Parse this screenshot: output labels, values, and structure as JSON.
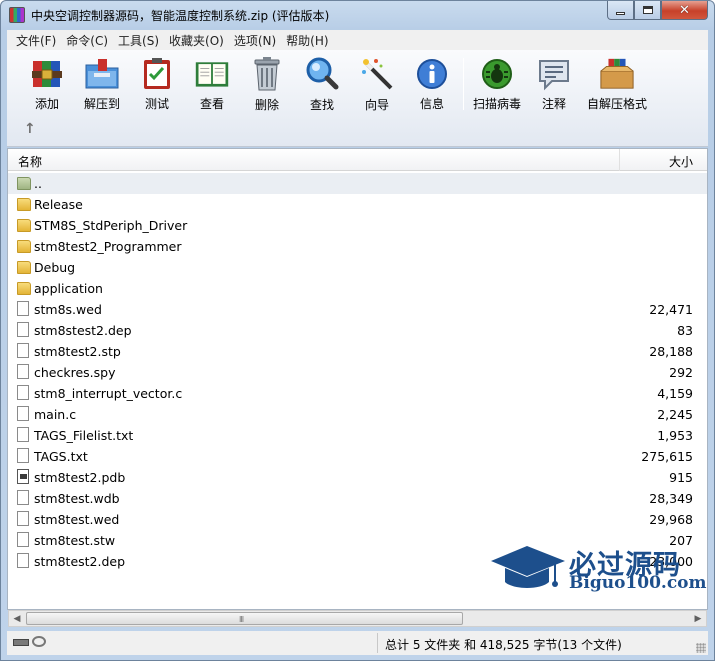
{
  "window": {
    "title": "中央空调控制器源码，智能温度控制系统.zip (评估版本)",
    "controls": {
      "minimize": "minimize-icon",
      "maximize": "maximize-icon",
      "close": "close-icon"
    }
  },
  "menu": [
    "文件(F)",
    "命令(C)",
    "工具(S)",
    "收藏夹(O)",
    "选项(N)",
    "帮助(H)"
  ],
  "toolbar": {
    "buttons": [
      {
        "label": "添加",
        "icon": "add-archive-icon"
      },
      {
        "label": "解压到",
        "icon": "extract-folder-icon"
      },
      {
        "label": "测试",
        "icon": "test-clipboard-icon"
      },
      {
        "label": "查看",
        "icon": "view-book-icon"
      },
      {
        "label": "删除",
        "icon": "trash-can-icon"
      },
      {
        "label": "查找",
        "icon": "magnifier-icon"
      },
      {
        "label": "向导",
        "icon": "wizard-wand-icon"
      },
      {
        "label": "信息",
        "icon": "info-icon"
      },
      {
        "label": "扫描病毒",
        "icon": "bug-scan-icon"
      },
      {
        "label": "注释",
        "icon": "comment-icon"
      },
      {
        "label": "自解压格式",
        "icon": "sfx-box-icon"
      }
    ],
    "up_icon": "up-arrow-icon"
  },
  "filelist": {
    "columns": {
      "name": "名称",
      "size": "大小"
    },
    "rows": [
      {
        "name": "..",
        "size": "",
        "type": "up"
      },
      {
        "name": "Release",
        "size": "",
        "type": "folder"
      },
      {
        "name": "STM8S_StdPeriph_Driver",
        "size": "",
        "type": "folder"
      },
      {
        "name": "stm8test2_Programmer",
        "size": "",
        "type": "folder"
      },
      {
        "name": "Debug",
        "size": "",
        "type": "folder"
      },
      {
        "name": "application",
        "size": "",
        "type": "folder"
      },
      {
        "name": "stm8s.wed",
        "size": "22,471",
        "type": "file"
      },
      {
        "name": "stm8stest2.dep",
        "size": "83",
        "type": "file"
      },
      {
        "name": "stm8test2.stp",
        "size": "28,188",
        "type": "file"
      },
      {
        "name": "checkres.spy",
        "size": "292",
        "type": "file"
      },
      {
        "name": "stm8_interrupt_vector.c",
        "size": "4,159",
        "type": "file"
      },
      {
        "name": "main.c",
        "size": "2,245",
        "type": "file"
      },
      {
        "name": "TAGS_Filelist.txt",
        "size": "1,953",
        "type": "file"
      },
      {
        "name": "TAGS.txt",
        "size": "275,615",
        "type": "file"
      },
      {
        "name": "stm8test2.pdb",
        "size": "915",
        "type": "pdb"
      },
      {
        "name": "stm8test.wdb",
        "size": "28,349",
        "type": "file"
      },
      {
        "name": "stm8test.wed",
        "size": "29,968",
        "type": "file"
      },
      {
        "name": "stm8test.stw",
        "size": "207",
        "type": "file"
      },
      {
        "name": "stm8test2.dep",
        "size": "23,000",
        "type": "file"
      }
    ]
  },
  "watermark": {
    "cn": "必过源码",
    "en": "Biguo100.com"
  },
  "scrollbar": {
    "grip": "III"
  },
  "status": {
    "text": "总计 5 文件夹 和 418,525 字节(13 个文件)"
  }
}
